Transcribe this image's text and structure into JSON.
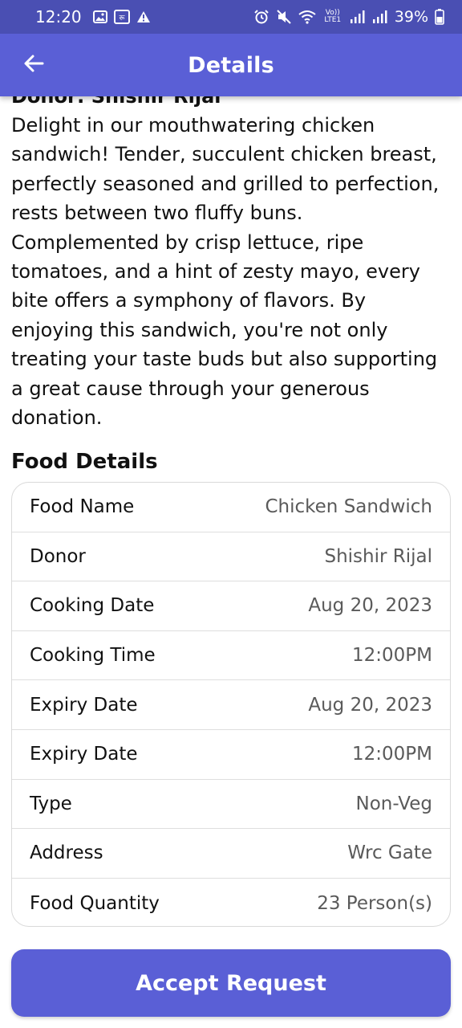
{
  "status_bar": {
    "time": "12:20",
    "network_label": "Vo)) LTE1",
    "battery": "39%",
    "icons": [
      "image-icon",
      "sim-icon",
      "warning-icon",
      "alarm-icon",
      "mute-icon",
      "wifi-icon",
      "signal-icon",
      "battery-icon"
    ]
  },
  "header": {
    "title": "Details",
    "back_icon": "arrow-left-icon"
  },
  "donor_line": "Donor: Shishir Rijal",
  "description": "Delight in our mouthwatering chicken sandwich! Tender, succulent chicken breast, perfectly seasoned and grilled to perfection, rests between two fluffy buns. Complemented by crisp lettuce, ripe tomatoes, and a hint of zesty mayo, every bite offers a symphony of flavors. By enjoying this sandwich, you're not only treating your taste buds but also supporting a great cause through your generous donation.",
  "food_details": {
    "title": "Food Details",
    "rows": [
      {
        "label": "Food Name",
        "value": "Chicken Sandwich"
      },
      {
        "label": "Donor",
        "value": "Shishir Rijal"
      },
      {
        "label": "Cooking Date",
        "value": "Aug 20, 2023"
      },
      {
        "label": "Cooking Time",
        "value": "12:00PM"
      },
      {
        "label": "Expiry Date",
        "value": "Aug 20, 2023"
      },
      {
        "label": "Expiry Date",
        "value": "12:00PM"
      },
      {
        "label": "Type",
        "value": "Non-Veg"
      },
      {
        "label": "Address",
        "value": "Wrc Gate"
      },
      {
        "label": "Food Quantity",
        "value": "23 Person(s)"
      }
    ]
  },
  "accept_button": "Accept Request",
  "colors": {
    "status_bar": "#4a4fb3",
    "app_bar": "#5a5fd6",
    "button": "#5a5fd6"
  }
}
